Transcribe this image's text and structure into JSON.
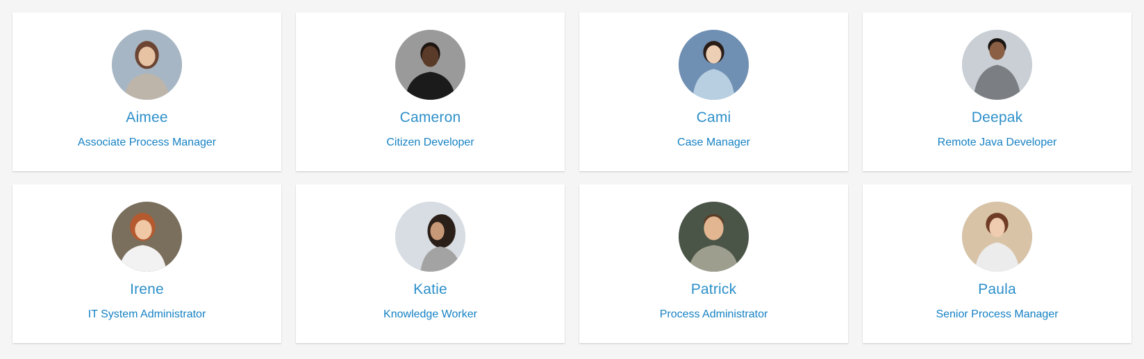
{
  "people": [
    {
      "name": "Aimee",
      "role": "Associate Process Manager",
      "bg": "#a7b6c4",
      "skin": "#e7c3a4",
      "hair": "#6b4432",
      "shirt": "#bdb5aa"
    },
    {
      "name": "Cameron",
      "role": "Citizen Developer",
      "bg": "#9a9a9a",
      "skin": "#5a3a28",
      "hair": "#1c1410",
      "shirt": "#1b1b1b"
    },
    {
      "name": "Cami",
      "role": "Case Manager",
      "bg": "#6f8fb3",
      "skin": "#edcfb6",
      "hair": "#2a1c17",
      "shirt": "#b8cfe2"
    },
    {
      "name": "Deepak",
      "role": "Remote Java Developer",
      "bg": "#c9cfd4",
      "skin": "#8b5f44",
      "hair": "#1b1512",
      "shirt": "#7b7f83"
    },
    {
      "name": "Irene",
      "role": "IT System Administrator",
      "bg": "#7a6e5c",
      "skin": "#f0c8a6",
      "hair": "#b5592e",
      "shirt": "#f2f2f2"
    },
    {
      "name": "Katie",
      "role": "Knowledge Worker",
      "bg": "#d7dde2",
      "skin": "#c79978",
      "hair": "#2b1f19",
      "shirt": "#a3a3a3"
    },
    {
      "name": "Patrick",
      "role": "Process Administrator",
      "bg": "#4a5447",
      "skin": "#e2b690",
      "hair": "#5a3c26",
      "shirt": "#9e9e8e"
    },
    {
      "name": "Paula",
      "role": "Senior Process Manager",
      "bg": "#d8c3a6",
      "skin": "#efcbb0",
      "hair": "#6f3b24",
      "shirt": "#ececec"
    }
  ]
}
